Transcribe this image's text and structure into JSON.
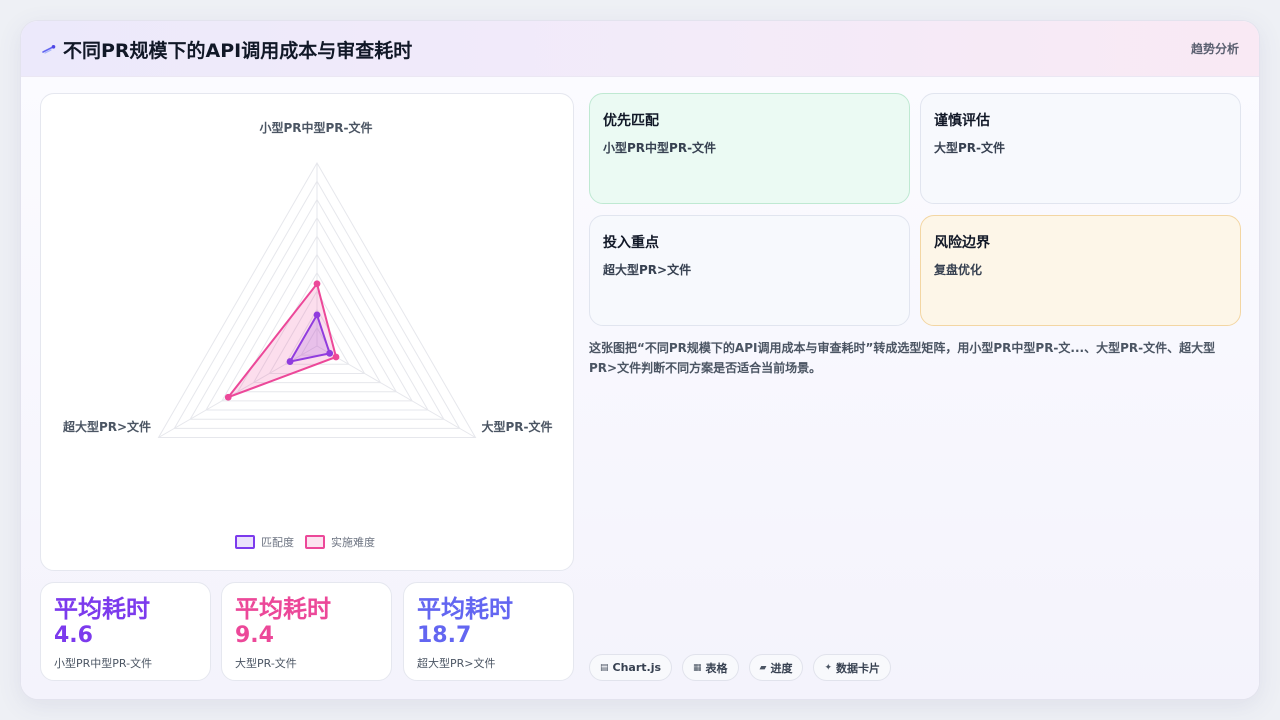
{
  "header": {
    "title": "不同PR规模下的API调用成本与审查耗时",
    "trend_label": "趋势分析",
    "logo_icon": "comet-icon"
  },
  "chart_data": {
    "type": "radar",
    "categories": [
      "小型PR中型PR-文件",
      "大型PR-文件",
      "超大型PR>文件"
    ],
    "rmax": 100,
    "grid_levels": 10,
    "series": [
      {
        "name": "匹配度",
        "values": [
          17,
          8,
          17
        ],
        "color": "#7c3aed"
      },
      {
        "name": "实施难度",
        "values": [
          34,
          12,
          56
        ],
        "color": "#ec4899"
      }
    ],
    "legend_position": "bottom",
    "grid": true
  },
  "stats": [
    {
      "label": "平均耗时",
      "value": "4.6",
      "sub": "小型PR中型PR-文件",
      "color": "#7c3aed"
    },
    {
      "label": "平均耗时",
      "value": "9.4",
      "sub": "大型PR-文件",
      "color": "#ec4899"
    },
    {
      "label": "平均耗时",
      "value": "18.7",
      "sub": "超大型PR>文件",
      "color": "#6366f1"
    }
  ],
  "tiles": [
    {
      "title": "优先匹配",
      "desc": "小型PR中型PR-文件"
    },
    {
      "title": "谨慎评估",
      "desc": "大型PR-文件"
    },
    {
      "title": "投入重点",
      "desc": "超大型PR>文件"
    },
    {
      "title": "风险边界",
      "desc": "复盘优化"
    }
  ],
  "description": "这张图把“不同PR规模下的API调用成本与审查耗时”转成选型矩阵，用小型PR中型PR-文...、大型PR-文件、超大型PR>文件判断不同方案是否适合当前场景。",
  "chips": [
    {
      "icon": "▤",
      "label": "Chart.js"
    },
    {
      "icon": "▦",
      "label": "表格"
    },
    {
      "icon": "▰",
      "label": "进度"
    },
    {
      "icon": "✦",
      "label": "数据卡片"
    }
  ]
}
